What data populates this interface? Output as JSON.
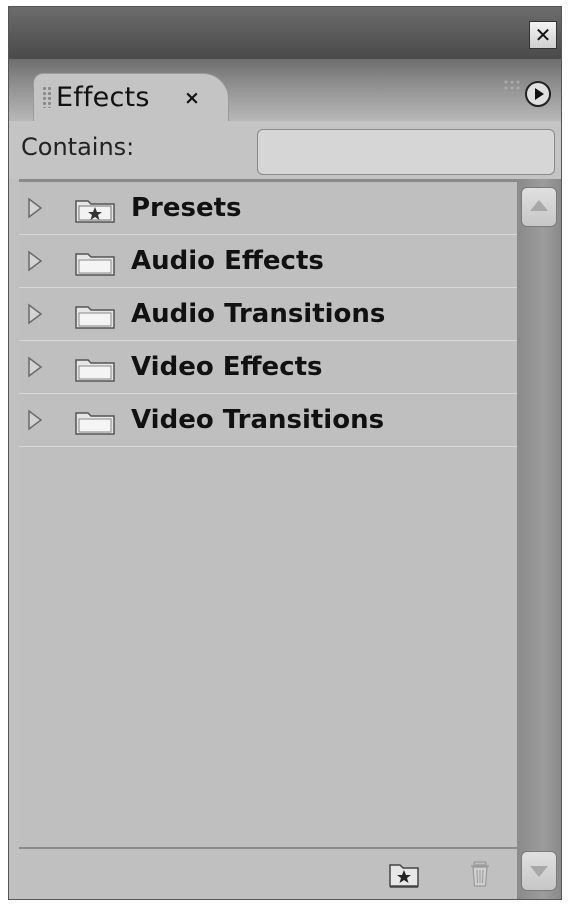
{
  "window": {
    "close_icon": "close-icon"
  },
  "tab": {
    "label": "Effects",
    "close_glyph": "×",
    "menu_icon": "panel-menu-icon"
  },
  "search": {
    "label": "Contains:",
    "value": "",
    "placeholder": ""
  },
  "tree": {
    "items": [
      {
        "label": "Presets",
        "icon": "preset-folder-icon"
      },
      {
        "label": "Audio Effects",
        "icon": "folder-icon"
      },
      {
        "label": "Audio Transitions",
        "icon": "folder-icon"
      },
      {
        "label": "Video Effects",
        "icon": "folder-icon"
      },
      {
        "label": "Video Transitions",
        "icon": "folder-icon"
      }
    ]
  },
  "footer": {
    "new_bin_icon": "new-custom-bin-icon",
    "delete_icon": "trash-icon"
  },
  "colors": {
    "panel_bg": "#c0c0c0",
    "titlebar_bg": "#4a4a4a",
    "text": "#111111"
  }
}
